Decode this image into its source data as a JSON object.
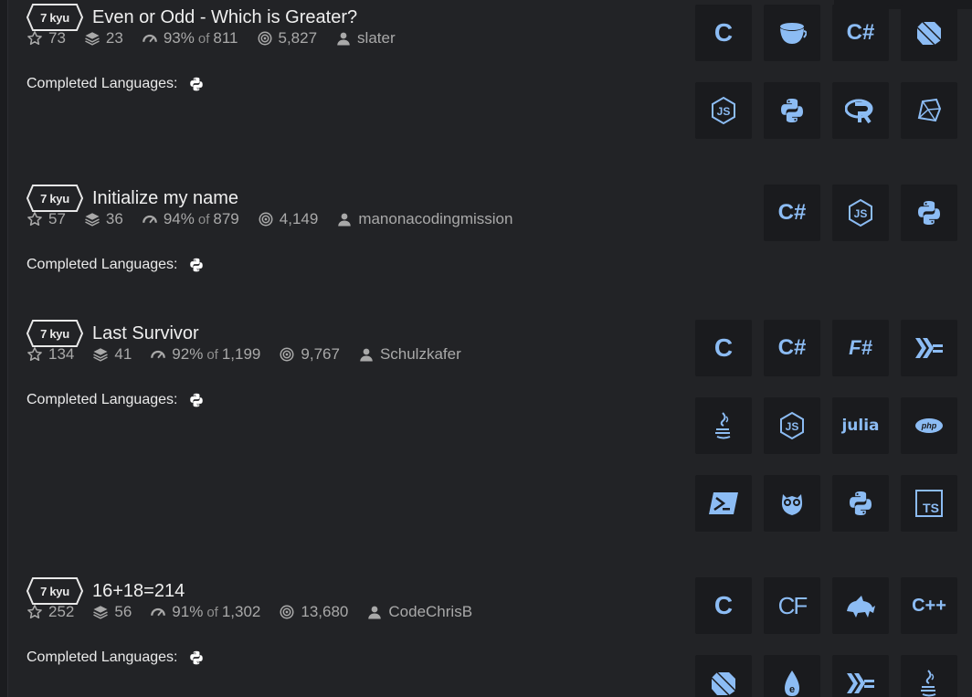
{
  "colors": {
    "background": "#222326",
    "tile": "#1a1b1e",
    "accent": "#8cbcf4",
    "text": "#eaeaea",
    "muted": "#a9a9a9"
  },
  "completed_label": "Completed Languages:",
  "katas": [
    {
      "rank": "7 kyu",
      "title": "Even or Odd - Which is Greater?",
      "stars": "73",
      "collections": "23",
      "satisfaction": "93%",
      "of": "of",
      "votes": "811",
      "completions": "5,827",
      "author": "slater",
      "completed_languages": [
        "python-icon"
      ],
      "languages": [
        "C",
        "CoffeeScript",
        "C#",
        "Dart",
        "JavaScript",
        "Python",
        "R",
        "Ruby"
      ]
    },
    {
      "rank": "7 kyu",
      "title": "Initialize my name",
      "stars": "57",
      "collections": "36",
      "satisfaction": "94%",
      "of": "of",
      "votes": "879",
      "completions": "4,149",
      "author": "manonacodingmission",
      "completed_languages": [
        "python-icon"
      ],
      "languages": [
        "C#",
        "JavaScript",
        "Python"
      ]
    },
    {
      "rank": "7 kyu",
      "title": "Last Survivor",
      "stars": "134",
      "collections": "41",
      "satisfaction": "92%",
      "of": "of",
      "votes": "1,199",
      "completions": "9,767",
      "author": "Schulzkafer",
      "completed_languages": [
        "python-icon"
      ],
      "languages": [
        "C",
        "C#",
        "F#",
        "Haskell",
        "Java",
        "JavaScript",
        "Julia",
        "PHP",
        "PowerShell",
        "Lua",
        "Python",
        "TypeScript"
      ]
    },
    {
      "rank": "7 kyu",
      "title": "16+18=214",
      "stars": "252",
      "collections": "56",
      "satisfaction": "91%",
      "of": "of",
      "votes": "1,302",
      "completions": "13,680",
      "author": "CodeChrisB",
      "completed_languages": [
        "python-icon"
      ],
      "languages": [
        "C",
        "CFML",
        "COBOL",
        "C++",
        "Dart",
        "Elixir",
        "Haskell",
        "Java"
      ]
    }
  ]
}
